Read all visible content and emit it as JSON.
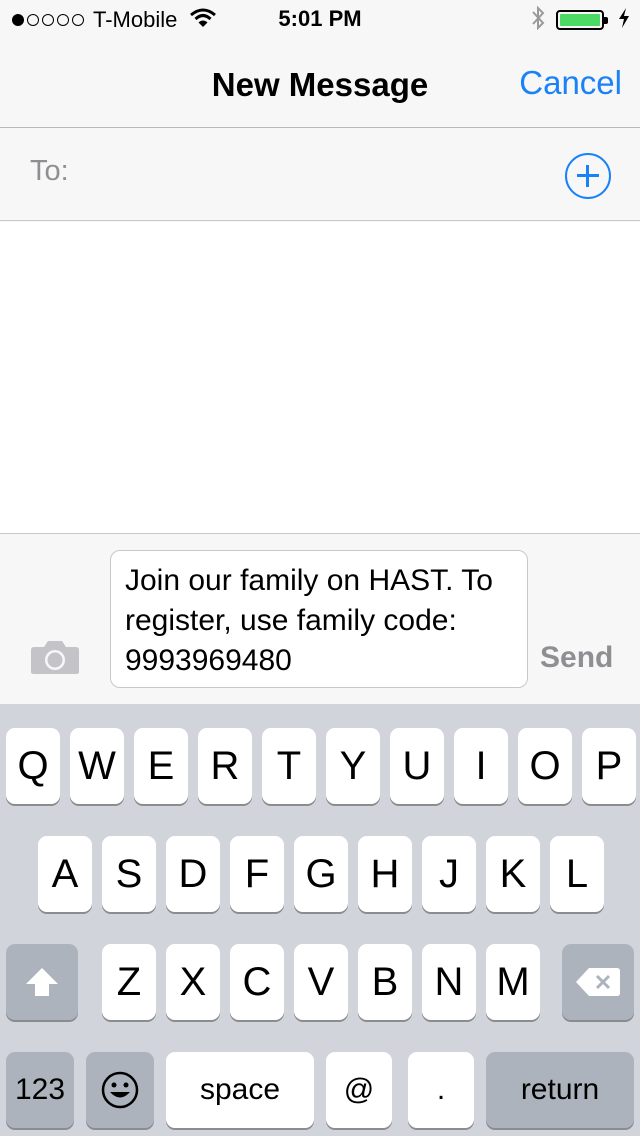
{
  "status_bar": {
    "signal_dots": [
      true,
      false,
      false,
      false,
      false
    ],
    "carrier": "T-Mobile",
    "wifi_icon": "wifi-icon",
    "time": "5:01 PM",
    "bluetooth_icon": "bluetooth-icon",
    "battery_level": 1.0,
    "charging_icon": "bolt-icon"
  },
  "nav": {
    "title": "New Message",
    "cancel_label": "Cancel"
  },
  "to_field": {
    "label": "To:",
    "value": "",
    "add_icon": "plus-circle-icon"
  },
  "compose": {
    "camera_icon": "camera-icon",
    "message_text": "Join our family on HAST. To register, use family code: 9993969480",
    "send_label": "Send"
  },
  "keyboard": {
    "row1": [
      "Q",
      "W",
      "E",
      "R",
      "T",
      "Y",
      "U",
      "I",
      "O",
      "P"
    ],
    "row2": [
      "A",
      "S",
      "D",
      "F",
      "G",
      "H",
      "J",
      "K",
      "L"
    ],
    "row3": [
      "Z",
      "X",
      "C",
      "V",
      "B",
      "N",
      "M"
    ],
    "shift_icon": "shift-arrow-icon",
    "delete_icon": "delete-backspace-icon",
    "numbers_label": "123",
    "emoji_icon": "emoji-smiley-icon",
    "space_label": "space",
    "at_label": "@",
    "period_label": ".",
    "return_label": "return"
  },
  "colors": {
    "accent": "#1a82f7",
    "battery_green": "#4cd964",
    "muted": "#8e8e93"
  }
}
